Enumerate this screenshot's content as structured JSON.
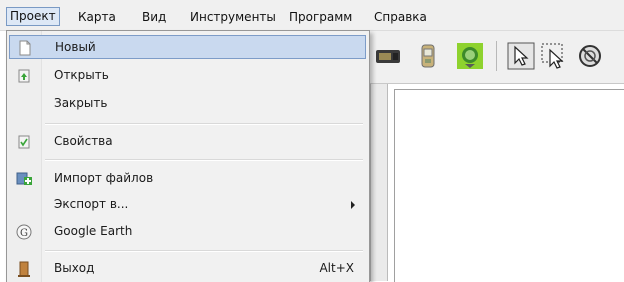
{
  "menubar": {
    "items": [
      {
        "label": "Проект"
      },
      {
        "label": "Карта"
      },
      {
        "label": "Вид"
      },
      {
        "label": "Инструменты"
      },
      {
        "label": "Программ"
      },
      {
        "label": "Справка"
      }
    ]
  },
  "project_menu": {
    "items": [
      {
        "label": "Новый",
        "icon": "new-document-icon",
        "selected": true
      },
      {
        "label": "Открыть",
        "icon": "open-icon"
      },
      {
        "label": "Закрыть"
      },
      {
        "label": "Свойства",
        "icon": "properties-icon"
      },
      {
        "label": "Импорт файлов",
        "icon": "import-icon"
      },
      {
        "label": "Экспорт в...",
        "submenu": true
      },
      {
        "label": "Google Earth",
        "icon": "google-earth-icon"
      },
      {
        "label": "Выход",
        "icon": "exit-icon",
        "shortcut": "Alt+X"
      }
    ]
  },
  "toolbar": {
    "icons": [
      "gps-device-icon",
      "handheld-device-icon",
      "globe-icon",
      "select-arrow-icon",
      "select-region-icon",
      "no-entry-icon"
    ]
  },
  "colors": {
    "selection_bg": "#c9d9ef",
    "selection_border": "#7d9cc8",
    "menubar_bg": "#f0f0f0"
  }
}
